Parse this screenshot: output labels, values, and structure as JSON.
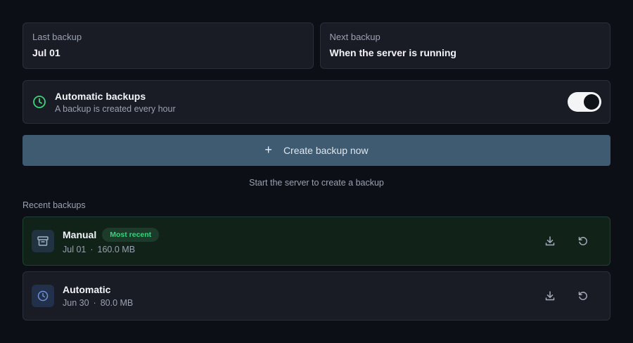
{
  "summary": {
    "last_backup": {
      "label": "Last backup",
      "value": "Jul 01"
    },
    "next_backup": {
      "label": "Next backup",
      "value": "When the server is running"
    }
  },
  "automatic": {
    "title": "Automatic backups",
    "subtitle": "A backup is created every hour",
    "enabled": true,
    "icon": "clock-icon"
  },
  "create_button": {
    "icon": "plus",
    "label": "Create backup now"
  },
  "hint": "Start the server to create a backup",
  "recent": {
    "title": "Recent backups",
    "items": [
      {
        "name": "Manual",
        "badge": "Most recent",
        "date": "Jul 01",
        "separator": "·",
        "size": "160.0 MB",
        "icon": "archive-icon"
      },
      {
        "name": "Automatic",
        "date": "Jun 30",
        "separator": "·",
        "size": "80.0 MB",
        "icon": "clock-icon"
      }
    ]
  },
  "colors": {
    "accent_green": "#3bd27a",
    "button_bg": "#3f5b72",
    "background": "#0c0f16"
  }
}
